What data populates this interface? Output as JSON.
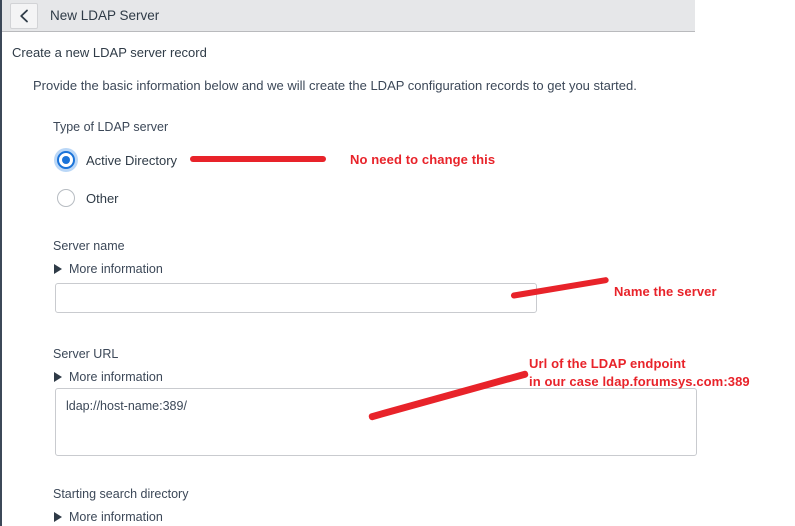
{
  "header": {
    "title": "New LDAP Server",
    "back_icon": "chevron-left-icon"
  },
  "page": {
    "heading": "Create a new LDAP server record",
    "intro": "Provide the basic information below and we will create the LDAP configuration records to get you started."
  },
  "fields": {
    "server_type": {
      "label": "Type of LDAP server",
      "options": [
        {
          "label": "Active Directory",
          "selected": true
        },
        {
          "label": "Other",
          "selected": false
        }
      ]
    },
    "server_name": {
      "label": "Server name",
      "more_information": "More information",
      "value": "",
      "placeholder": ""
    },
    "server_url": {
      "label": "Server URL",
      "more_information": "More information",
      "value": "ldap://host-name:389/"
    },
    "starting_search_directory": {
      "label": "Starting search directory",
      "more_information": "More information"
    }
  },
  "annotations": {
    "color": "#e8232a",
    "server_type_note": "No need to change this",
    "server_name_note": "Name the server",
    "server_url_note_line1": "Url of the LDAP endpoint",
    "server_url_note_line2": "in our case  ldap.forumsys.com:389"
  },
  "colors": {
    "header_bg": "#e6e7e9",
    "accent_blue": "#1a73d9",
    "text": "#2f3b47",
    "annotation_red": "#e8232a"
  }
}
